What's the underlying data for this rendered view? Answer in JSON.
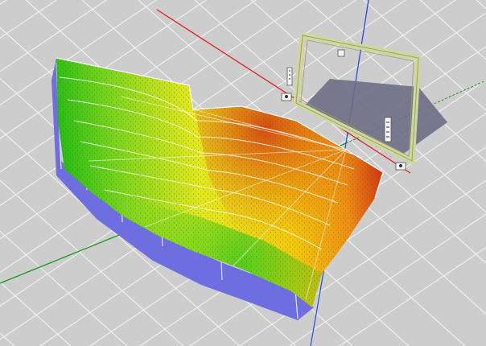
{
  "viewport": {
    "background": "#cdcdcd",
    "grid_color": "#f2f2f2",
    "axis_colors": {
      "x": "#e02020",
      "y": "#1a9a1a",
      "z": "#2050e0"
    }
  },
  "screen": {
    "frame_color": "#cfd79a",
    "shadow_color": "#6e6e86"
  },
  "audience_area": {
    "heatmap_colors": [
      "#14b414",
      "#78d21e",
      "#e6e61e",
      "#f5c80a",
      "#f08c14",
      "#d23214"
    ],
    "side_wall_color": "#6e6ee0",
    "riser_line_color": "#ffffff"
  },
  "speakers": {
    "icon": "speaker-icon",
    "count": 5
  }
}
